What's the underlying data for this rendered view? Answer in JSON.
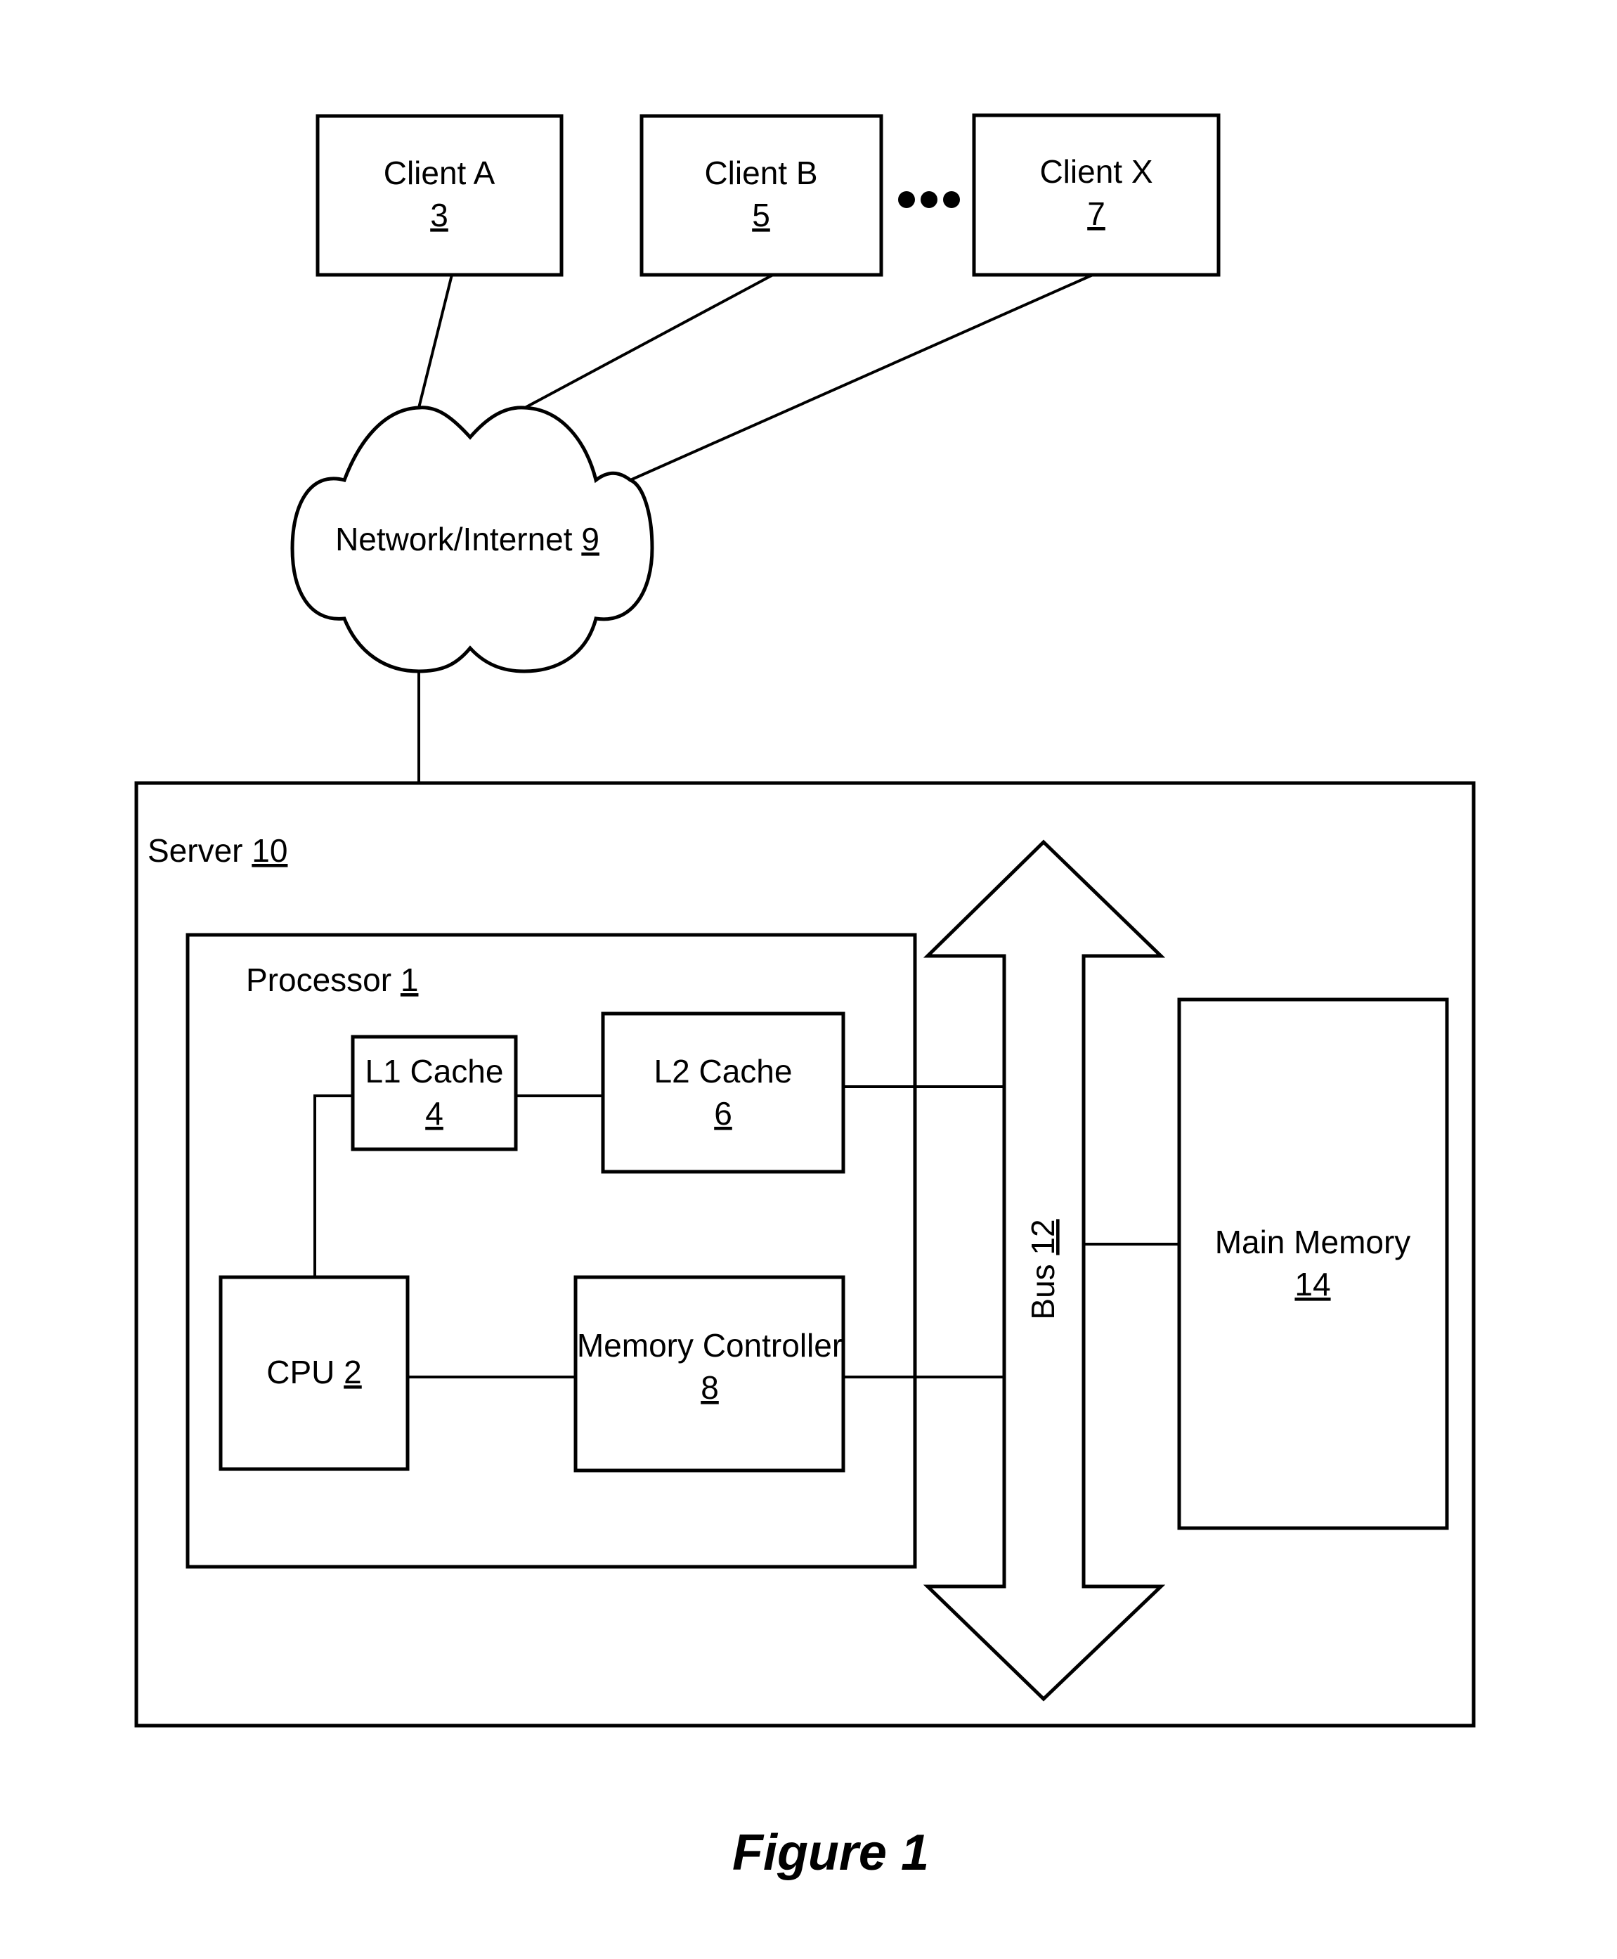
{
  "figure": {
    "caption": "Figure 1"
  },
  "clients": [
    {
      "name": "Client A",
      "ref": "3"
    },
    {
      "name": "Client B",
      "ref": "5"
    },
    {
      "name": "Client X",
      "ref": "7"
    }
  ],
  "ellipsis": "•••",
  "network": {
    "name": "Network/Internet",
    "ref": "9"
  },
  "server": {
    "name": "Server",
    "ref": "10"
  },
  "processor": {
    "name": "Processor",
    "ref": "1"
  },
  "l1_cache": {
    "name": "L1 Cache",
    "ref": "4"
  },
  "l2_cache": {
    "name": "L2 Cache",
    "ref": "6"
  },
  "cpu": {
    "name": "CPU",
    "ref": "2"
  },
  "memory_controller": {
    "name": "Memory Controller",
    "ref": "8"
  },
  "bus": {
    "name": "Bus",
    "ref": "12"
  },
  "main_memory": {
    "name": "Main Memory",
    "ref": "14"
  }
}
